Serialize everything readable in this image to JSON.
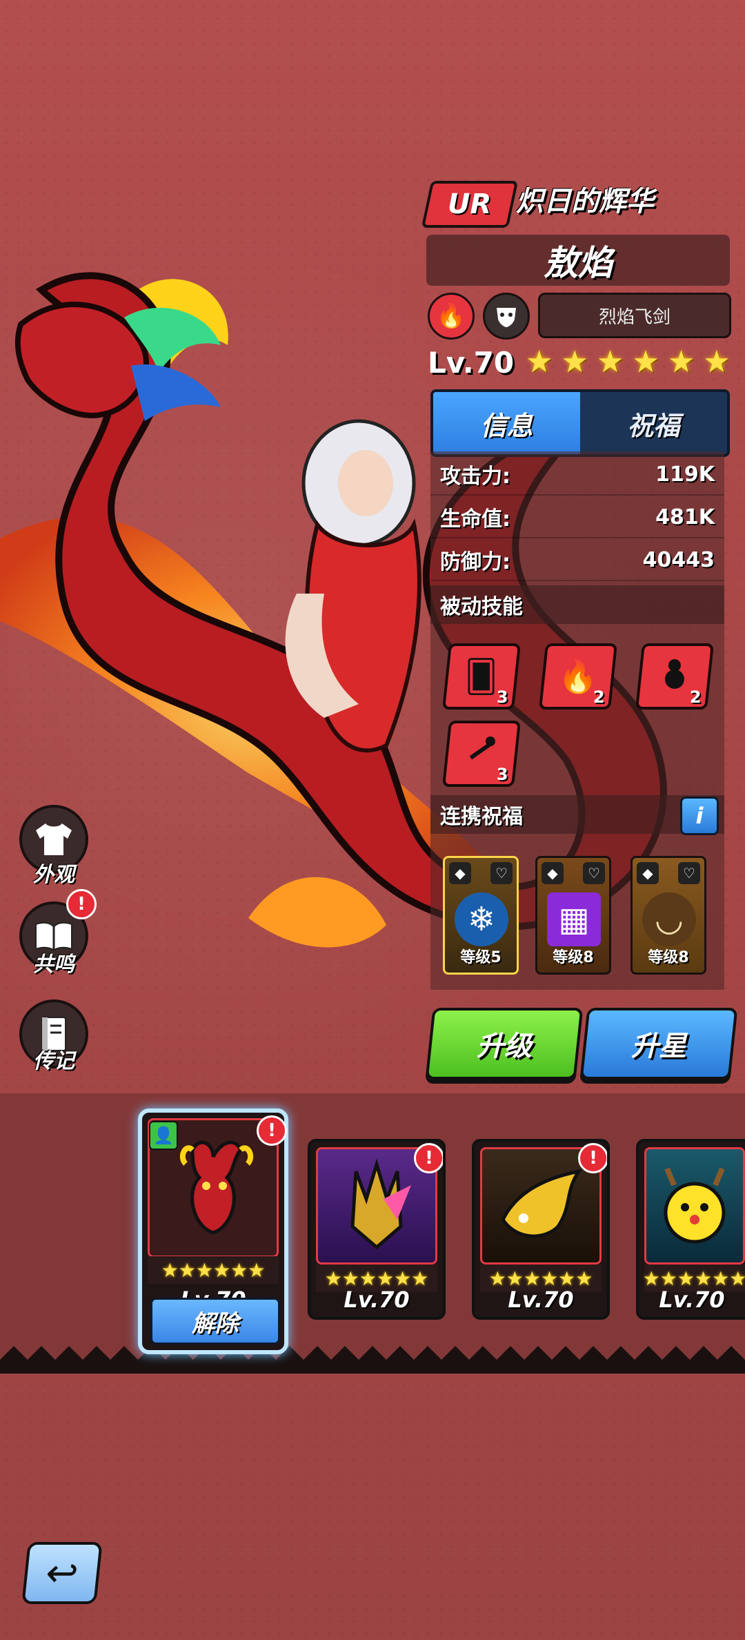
{
  "hero": {
    "rarity": "UR",
    "title": "炽日的辉华",
    "name": "敖焰",
    "weapon": "烈焰飞剑",
    "level": "Lv.70",
    "stars": 6,
    "element_icon": "fire-icon",
    "class_icon": "mask-icon"
  },
  "tabs": [
    {
      "label": "信息",
      "active": true
    },
    {
      "label": "祝福",
      "active": false
    }
  ],
  "stats": [
    {
      "label": "攻击力:",
      "value": "119K"
    },
    {
      "label": "生命值:",
      "value": "481K"
    },
    {
      "label": "防御力:",
      "value": "40443"
    }
  ],
  "passive": {
    "heading": "被动技能",
    "skills": [
      {
        "icon": "cards-icon",
        "level": "3"
      },
      {
        "icon": "flame-icon",
        "level": "2"
      },
      {
        "icon": "gourd-icon",
        "level": "2"
      },
      {
        "icon": "staff-icon",
        "level": "3"
      }
    ]
  },
  "bless": {
    "heading": "连携祝福",
    "info_label": "i",
    "cards": [
      {
        "icon": "dragon-orb-icon",
        "label": "等级5",
        "color": "#b8861d"
      },
      {
        "icon": "stage-icon",
        "label": "等级8",
        "color": "#9a6a2a"
      },
      {
        "icon": "claw-necklace-icon",
        "label": "等级8",
        "color": "#9a6a2a"
      }
    ]
  },
  "actions": {
    "upgrade": "升级",
    "star_up": "升星"
  },
  "side": {
    "appearance": "外观",
    "resonance": "共鸣",
    "biography": "传记",
    "badge": "!"
  },
  "pets": [
    {
      "level": "Lv.70",
      "icon": "dragon-head-icon",
      "selected": true,
      "stars": 6
    },
    {
      "level": "Lv.70",
      "icon": "horned-helmet-icon",
      "selected": false,
      "stars": 6
    },
    {
      "level": "Lv.70",
      "icon": "beast-claw-icon",
      "selected": false,
      "stars": 6
    },
    {
      "level": "Lv.70",
      "icon": "reindeer-icon",
      "selected": false,
      "stars": 6
    }
  ],
  "release_label": "解除"
}
